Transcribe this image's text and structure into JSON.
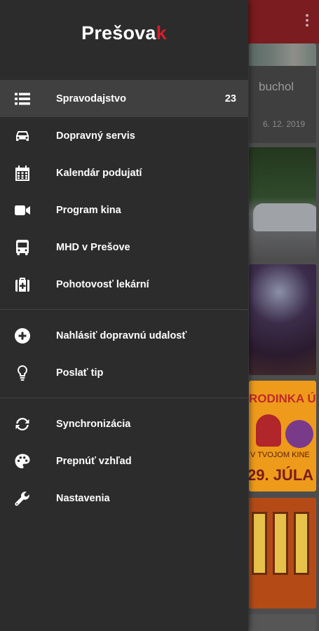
{
  "app": {
    "logo_main": "Prešova",
    "logo_accent": "k",
    "brand_color": "#d21f2a"
  },
  "drawer": {
    "sections": [
      {
        "items": [
          {
            "label": "Spravodajstvo",
            "icon": "list-icon",
            "badge": "23",
            "active": true
          },
          {
            "label": "Dopravný servis",
            "icon": "car-icon"
          },
          {
            "label": "Kalendár podujatí",
            "icon": "calendar-icon"
          },
          {
            "label": "Program kina",
            "icon": "video-camera-icon"
          },
          {
            "label": "MHD v Prešove",
            "icon": "bus-icon"
          },
          {
            "label": "Pohotovosť lekární",
            "icon": "medkit-icon"
          }
        ]
      },
      {
        "items": [
          {
            "label": "Nahlásiť dopravnú udalosť",
            "icon": "plus-circle-icon"
          },
          {
            "label": "Poslať tip",
            "icon": "lightbulb-icon"
          }
        ]
      },
      {
        "items": [
          {
            "label": "Synchronizácia",
            "icon": "sync-icon"
          },
          {
            "label": "Prepnúť vzhľad",
            "icon": "palette-icon"
          },
          {
            "label": "Nastavenia",
            "icon": "wrench-icon"
          }
        ]
      }
    ]
  },
  "background": {
    "card1_title": "buchol",
    "card1_date": "6. 12. 2019",
    "card4_text1": "RODINKA ÚŽA",
    "card4_text2": "V TVOJOM KINE",
    "card4_text3": "29. JÚLA"
  }
}
